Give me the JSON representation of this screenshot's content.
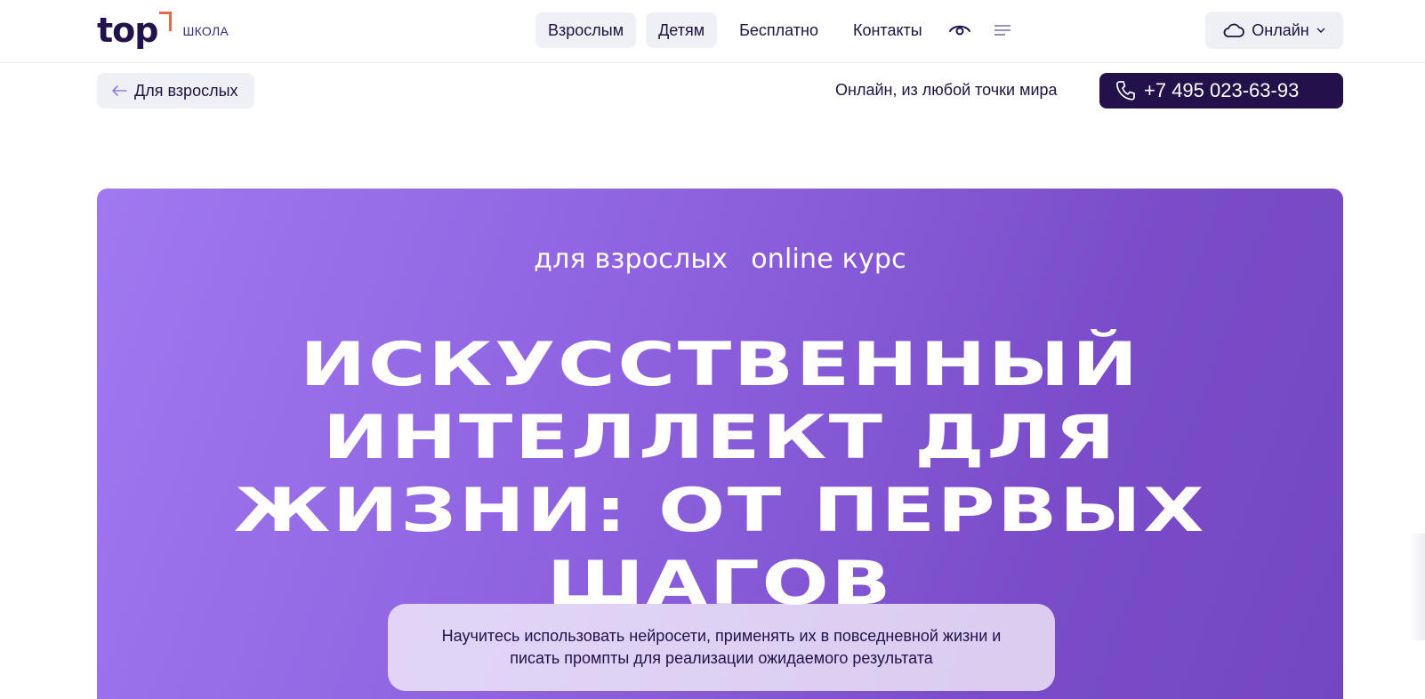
{
  "header": {
    "logo_text": "top",
    "logo_sub": "ШКОЛА",
    "nav": [
      {
        "label": "Взрослым",
        "active": true
      },
      {
        "label": "Детям",
        "active": true
      },
      {
        "label": "Бесплатно",
        "active": false
      },
      {
        "label": "Контакты",
        "active": false
      }
    ],
    "icons": [
      "eye-icon",
      "menu-icon",
      "cloud-icon",
      "chevron-down-icon"
    ],
    "city_label": "Онлайн"
  },
  "subheader": {
    "back_label": "Для взрослых",
    "online_text": "Онлайн, из любой точки мира",
    "phone": "+7 495 023-63-93"
  },
  "hero": {
    "tag_audience": "для взрослых",
    "tag_format": "online курс",
    "title": "ИСКУССТВЕННЫЙ ИНТЕЛЛЕКТ ДЛЯ ЖИЗНИ: ОТ ПЕРВЫХ ШАГОВ",
    "description": "Научитесь использовать нейросети, применять их в повседневной жизни и писать промпты для реализации ожидаемого результата"
  },
  "colors": {
    "brand_dark": "#22114a",
    "accent_orange": "#e06a4a",
    "hero_start": "#a078f0",
    "hero_end": "#7447c2",
    "pill_bg": "#eef0f5"
  }
}
